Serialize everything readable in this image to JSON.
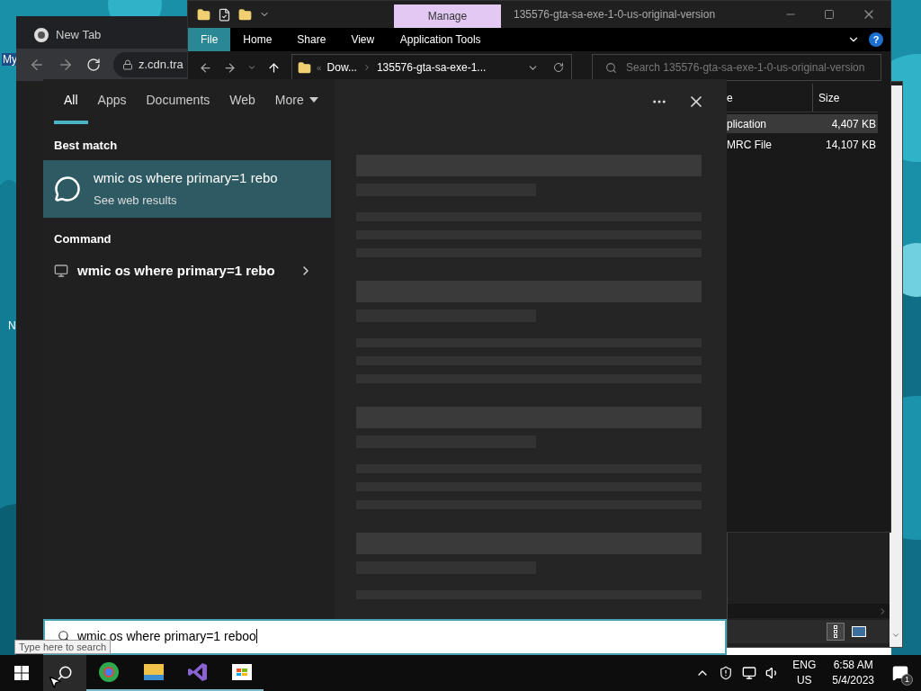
{
  "desktop": {
    "icon_labels": [
      {
        "label": "My",
        "selected": true
      },
      {
        "label": "N",
        "selected": false
      }
    ]
  },
  "browser": {
    "tab_title": "New Tab",
    "url": "z.cdn.tra"
  },
  "explorer": {
    "contextual_tab": "Manage",
    "title": "135576-gta-sa-exe-1-0-us-original-version",
    "ribbon_tabs": [
      {
        "label": "File",
        "selected": true
      },
      {
        "label": "Home",
        "selected": false
      },
      {
        "label": "Share",
        "selected": false
      },
      {
        "label": "View",
        "selected": false
      },
      {
        "label": "Application Tools",
        "selected": false
      }
    ],
    "help": "?",
    "address_prefix": "«",
    "address": [
      "Dow...",
      "135576-gta-sa-exe-1..."
    ],
    "search_placeholder": "Search 135576-gta-sa-exe-1-0-us-original-version",
    "columns": [
      "e",
      "Size"
    ],
    "rows": [
      {
        "type": "plication",
        "size": "4,407 KB",
        "selected": true
      },
      {
        "type": "MRC File",
        "size": "14,107 KB",
        "selected": false
      }
    ]
  },
  "search_panel": {
    "tabs": [
      {
        "label": "All",
        "selected": true
      },
      {
        "label": "Apps",
        "selected": false
      },
      {
        "label": "Documents",
        "selected": false
      },
      {
        "label": "Web",
        "selected": false
      },
      {
        "label": "More",
        "selected": false
      }
    ],
    "sections": [
      {
        "heading": "Best match",
        "items": [
          {
            "kind": "web",
            "title": "wmic os where primary=1 rebo",
            "subtitle": "See web results",
            "selected": true
          }
        ]
      },
      {
        "heading": "Command",
        "items": [
          {
            "kind": "command",
            "title": "wmic os where primary=1 rebo",
            "selected": false
          }
        ]
      }
    ],
    "query": "wmic os where primary=1 reboo"
  },
  "tooltip": "Type here to search",
  "tray": {
    "language": "ENG",
    "region": "US",
    "time": "6:58 AM",
    "date": "5/4/2023",
    "notifications": "1"
  }
}
